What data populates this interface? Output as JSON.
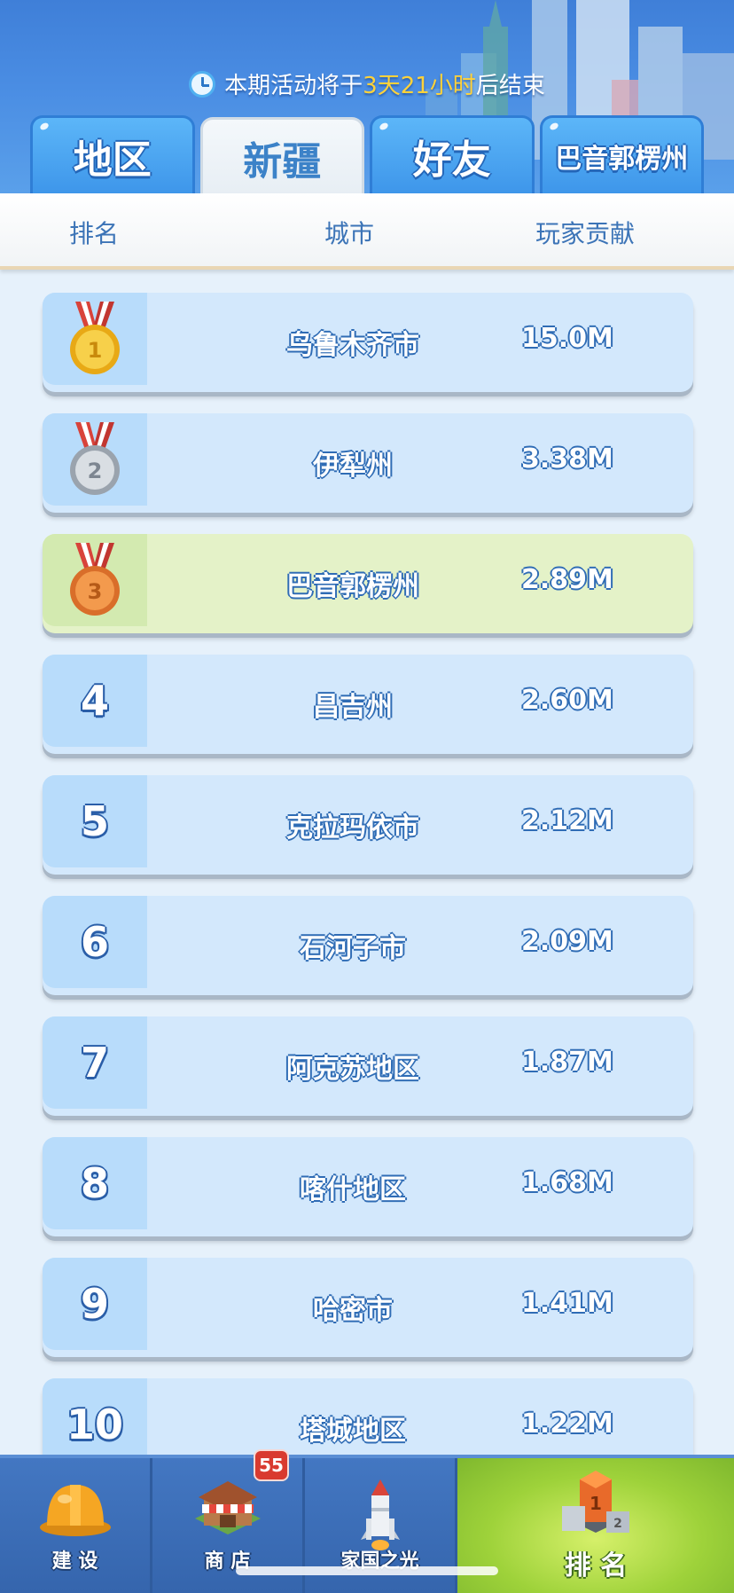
{
  "timer": {
    "prefix": "本期活动将于",
    "highlight": "3天21小时",
    "suffix": "后结束"
  },
  "tabs": [
    {
      "label": "地区",
      "active": false
    },
    {
      "label": "新疆",
      "active": true
    },
    {
      "label": "好友",
      "active": false
    },
    {
      "label": "巴音郭楞州",
      "active": false
    }
  ],
  "columns": {
    "rank": "排名",
    "city": "城市",
    "contribution": "玩家贡献"
  },
  "rows": [
    {
      "rank": "1",
      "city": "乌鲁木齐市",
      "score": "15.0M",
      "medal": "gold"
    },
    {
      "rank": "2",
      "city": "伊犁州",
      "score": "3.38M",
      "medal": "silver"
    },
    {
      "rank": "3",
      "city": "巴音郭楞州",
      "score": "2.89M",
      "medal": "bronze"
    },
    {
      "rank": "4",
      "city": "昌吉州",
      "score": "2.60M"
    },
    {
      "rank": "5",
      "city": "克拉玛依市",
      "score": "2.12M"
    },
    {
      "rank": "6",
      "city": "石河子市",
      "score": "2.09M"
    },
    {
      "rank": "7",
      "city": "阿克苏地区",
      "score": "1.87M"
    },
    {
      "rank": "8",
      "city": "喀什地区",
      "score": "1.68M"
    },
    {
      "rank": "9",
      "city": "哈密市",
      "score": "1.41M"
    },
    {
      "rank": "10",
      "city": "塔城地区",
      "score": "1.22M"
    }
  ],
  "nav": {
    "build": "建 设",
    "shop": "商 店",
    "shop_badge": "55",
    "homeland": "家国之光",
    "ranking": "排 名"
  },
  "colors": {
    "accent_blue": "#3e96ea",
    "highlight_row": "#e4f2c8",
    "timer_highlight": "#ffd23a",
    "badge_red": "#d93a2f"
  }
}
